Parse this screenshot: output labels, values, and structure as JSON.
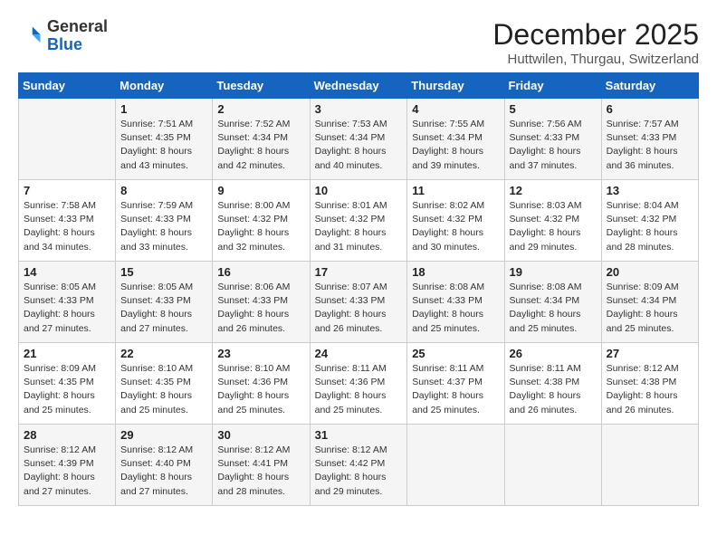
{
  "header": {
    "logo_general": "General",
    "logo_blue": "Blue",
    "month_year": "December 2025",
    "location": "Huttwilen, Thurgau, Switzerland"
  },
  "days_of_week": [
    "Sunday",
    "Monday",
    "Tuesday",
    "Wednesday",
    "Thursday",
    "Friday",
    "Saturday"
  ],
  "weeks": [
    [
      {
        "day": "",
        "info": ""
      },
      {
        "day": "1",
        "info": "Sunrise: 7:51 AM\nSunset: 4:35 PM\nDaylight: 8 hours\nand 43 minutes."
      },
      {
        "day": "2",
        "info": "Sunrise: 7:52 AM\nSunset: 4:34 PM\nDaylight: 8 hours\nand 42 minutes."
      },
      {
        "day": "3",
        "info": "Sunrise: 7:53 AM\nSunset: 4:34 PM\nDaylight: 8 hours\nand 40 minutes."
      },
      {
        "day": "4",
        "info": "Sunrise: 7:55 AM\nSunset: 4:34 PM\nDaylight: 8 hours\nand 39 minutes."
      },
      {
        "day": "5",
        "info": "Sunrise: 7:56 AM\nSunset: 4:33 PM\nDaylight: 8 hours\nand 37 minutes."
      },
      {
        "day": "6",
        "info": "Sunrise: 7:57 AM\nSunset: 4:33 PM\nDaylight: 8 hours\nand 36 minutes."
      }
    ],
    [
      {
        "day": "7",
        "info": "Sunrise: 7:58 AM\nSunset: 4:33 PM\nDaylight: 8 hours\nand 34 minutes."
      },
      {
        "day": "8",
        "info": "Sunrise: 7:59 AM\nSunset: 4:33 PM\nDaylight: 8 hours\nand 33 minutes."
      },
      {
        "day": "9",
        "info": "Sunrise: 8:00 AM\nSunset: 4:32 PM\nDaylight: 8 hours\nand 32 minutes."
      },
      {
        "day": "10",
        "info": "Sunrise: 8:01 AM\nSunset: 4:32 PM\nDaylight: 8 hours\nand 31 minutes."
      },
      {
        "day": "11",
        "info": "Sunrise: 8:02 AM\nSunset: 4:32 PM\nDaylight: 8 hours\nand 30 minutes."
      },
      {
        "day": "12",
        "info": "Sunrise: 8:03 AM\nSunset: 4:32 PM\nDaylight: 8 hours\nand 29 minutes."
      },
      {
        "day": "13",
        "info": "Sunrise: 8:04 AM\nSunset: 4:32 PM\nDaylight: 8 hours\nand 28 minutes."
      }
    ],
    [
      {
        "day": "14",
        "info": "Sunrise: 8:05 AM\nSunset: 4:33 PM\nDaylight: 8 hours\nand 27 minutes."
      },
      {
        "day": "15",
        "info": "Sunrise: 8:05 AM\nSunset: 4:33 PM\nDaylight: 8 hours\nand 27 minutes."
      },
      {
        "day": "16",
        "info": "Sunrise: 8:06 AM\nSunset: 4:33 PM\nDaylight: 8 hours\nand 26 minutes."
      },
      {
        "day": "17",
        "info": "Sunrise: 8:07 AM\nSunset: 4:33 PM\nDaylight: 8 hours\nand 26 minutes."
      },
      {
        "day": "18",
        "info": "Sunrise: 8:08 AM\nSunset: 4:33 PM\nDaylight: 8 hours\nand 25 minutes."
      },
      {
        "day": "19",
        "info": "Sunrise: 8:08 AM\nSunset: 4:34 PM\nDaylight: 8 hours\nand 25 minutes."
      },
      {
        "day": "20",
        "info": "Sunrise: 8:09 AM\nSunset: 4:34 PM\nDaylight: 8 hours\nand 25 minutes."
      }
    ],
    [
      {
        "day": "21",
        "info": "Sunrise: 8:09 AM\nSunset: 4:35 PM\nDaylight: 8 hours\nand 25 minutes."
      },
      {
        "day": "22",
        "info": "Sunrise: 8:10 AM\nSunset: 4:35 PM\nDaylight: 8 hours\nand 25 minutes."
      },
      {
        "day": "23",
        "info": "Sunrise: 8:10 AM\nSunset: 4:36 PM\nDaylight: 8 hours\nand 25 minutes."
      },
      {
        "day": "24",
        "info": "Sunrise: 8:11 AM\nSunset: 4:36 PM\nDaylight: 8 hours\nand 25 minutes."
      },
      {
        "day": "25",
        "info": "Sunrise: 8:11 AM\nSunset: 4:37 PM\nDaylight: 8 hours\nand 25 minutes."
      },
      {
        "day": "26",
        "info": "Sunrise: 8:11 AM\nSunset: 4:38 PM\nDaylight: 8 hours\nand 26 minutes."
      },
      {
        "day": "27",
        "info": "Sunrise: 8:12 AM\nSunset: 4:38 PM\nDaylight: 8 hours\nand 26 minutes."
      }
    ],
    [
      {
        "day": "28",
        "info": "Sunrise: 8:12 AM\nSunset: 4:39 PM\nDaylight: 8 hours\nand 27 minutes."
      },
      {
        "day": "29",
        "info": "Sunrise: 8:12 AM\nSunset: 4:40 PM\nDaylight: 8 hours\nand 27 minutes."
      },
      {
        "day": "30",
        "info": "Sunrise: 8:12 AM\nSunset: 4:41 PM\nDaylight: 8 hours\nand 28 minutes."
      },
      {
        "day": "31",
        "info": "Sunrise: 8:12 AM\nSunset: 4:42 PM\nDaylight: 8 hours\nand 29 minutes."
      },
      {
        "day": "",
        "info": ""
      },
      {
        "day": "",
        "info": ""
      },
      {
        "day": "",
        "info": ""
      }
    ]
  ]
}
